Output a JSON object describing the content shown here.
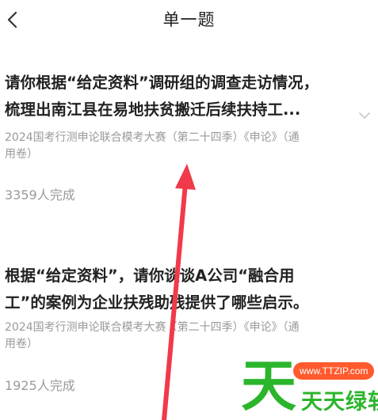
{
  "header": {
    "title": "单一题",
    "back_icon": "chevron-left-icon"
  },
  "questions": [
    {
      "title_lines": [
        "请你根据“给定资料”调研组的调查走访情况，",
        "梳理出南江县在易地扶贫搬迁后续扶持工..."
      ],
      "source_lines": [
        "2024国考行测申论联合模考大赛（第二十四季）《申论》（通",
        "用卷）"
      ],
      "completed": "3359人完成",
      "expand_icon": "chevron-down-icon"
    },
    {
      "title_lines": [
        "根据“给定资料”，请你谈谈A公司“融合用",
        "工”的案例为企业扶残助残提供了哪些启示。"
      ],
      "source_lines": [
        "2024国考行测申论联合模考大赛（第二十四季）《申论》（通",
        "用卷）"
      ],
      "completed": "1925人完成"
    }
  ],
  "watermark": {
    "big_char": "天",
    "url": "www.TTZIP.com",
    "name": "天天绿软",
    "green": "#2bb52b",
    "orange": "#ff5a2e"
  },
  "annotation": {
    "arrow_icon": "red-arrow-icon",
    "color": "#f03a4a"
  }
}
